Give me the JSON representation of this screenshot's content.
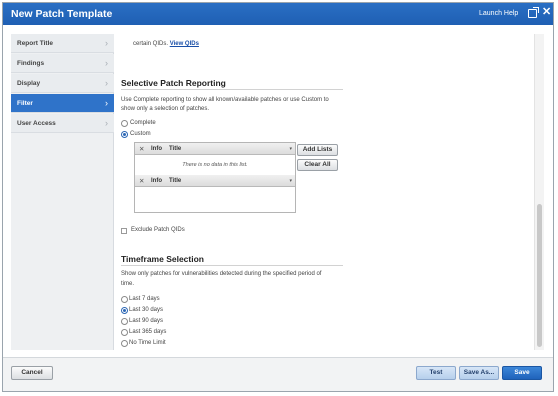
{
  "window": {
    "title": "New Patch Template",
    "help_label": "Launch Help"
  },
  "sidebar": {
    "items": [
      {
        "label": "Report Title"
      },
      {
        "label": "Findings"
      },
      {
        "label": "Display"
      },
      {
        "label": "Filter"
      },
      {
        "label": "User Access"
      }
    ]
  },
  "main": {
    "top_text": "certain QIDs.",
    "top_link": "View QIDs",
    "selective": {
      "heading": "Selective Patch Reporting",
      "desc_line1": "Use Complete reporting to show all known/available patches or use Custom to",
      "desc_line2": "show only a selection of patches.",
      "option_complete": "Complete",
      "option_custom": "Custom",
      "selected": "Custom",
      "list_col_info": "Info",
      "list_col_title": "Title",
      "list_empty": "There is no data in this list.",
      "add_lists_label": "Add Lists",
      "clear_all_label": "Clear All",
      "exclude_label": "Exclude Patch QIDs"
    },
    "timeframe": {
      "heading": "Timeframe Selection",
      "desc_line1": "Show only patches for vulnerabilities detected during the specified period of",
      "desc_line2": "time.",
      "options": [
        "Last 7 days",
        "Last 30 days",
        "Last 90 days",
        "Last 365 days",
        "No Time Limit"
      ],
      "selected": "Last 30 days"
    }
  },
  "footer": {
    "cancel_label": "Cancel",
    "test_label": "Test",
    "save_as_label": "Save As...",
    "save_label": "Save"
  }
}
